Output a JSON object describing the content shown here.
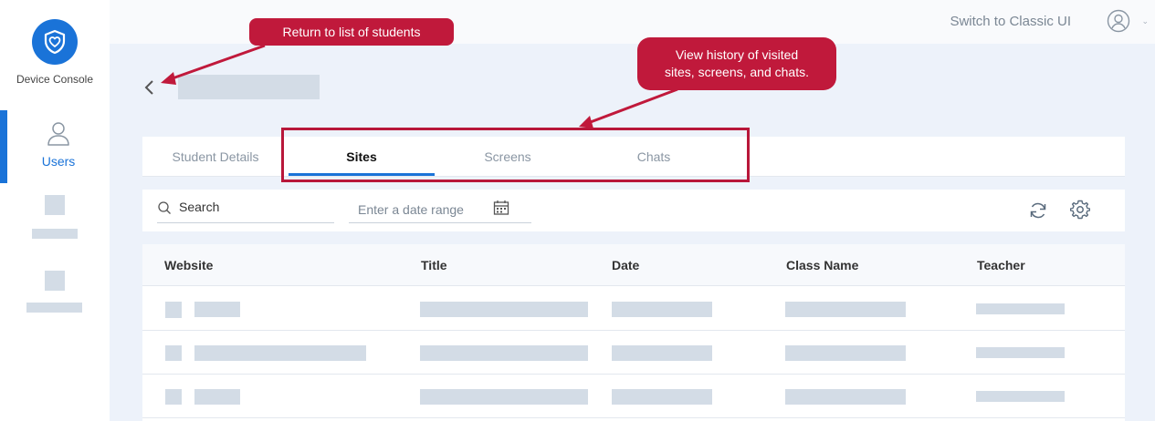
{
  "sidebar": {
    "logo_label": "Device Console",
    "items": [
      {
        "label": "Users",
        "icon": "user-icon",
        "active": true
      }
    ]
  },
  "topbar": {
    "switch_label": "Switch to Classic UI",
    "profile_icon": "profile-icon"
  },
  "header": {
    "back_icon": "chevron-left-icon"
  },
  "tabs": [
    {
      "label": "Student Details",
      "active": false
    },
    {
      "label": "Sites",
      "active": true
    },
    {
      "label": "Screens",
      "active": false
    },
    {
      "label": "Chats",
      "active": false
    }
  ],
  "toolbar": {
    "search_label": "Search",
    "date_placeholder": "Enter a date range"
  },
  "table": {
    "columns": [
      "Website",
      "Title",
      "Date",
      "Class Name",
      "Teacher"
    ]
  },
  "annotations": {
    "back_callout": "Return to list of students",
    "tabs_callout_line1": "View history of visited",
    "tabs_callout_line2": "sites, screens, and chats."
  },
  "colors": {
    "accent": "#1a73d8",
    "callout": "#c0193b",
    "placeholder": "#d3dce6",
    "background": "#edf2fa"
  }
}
